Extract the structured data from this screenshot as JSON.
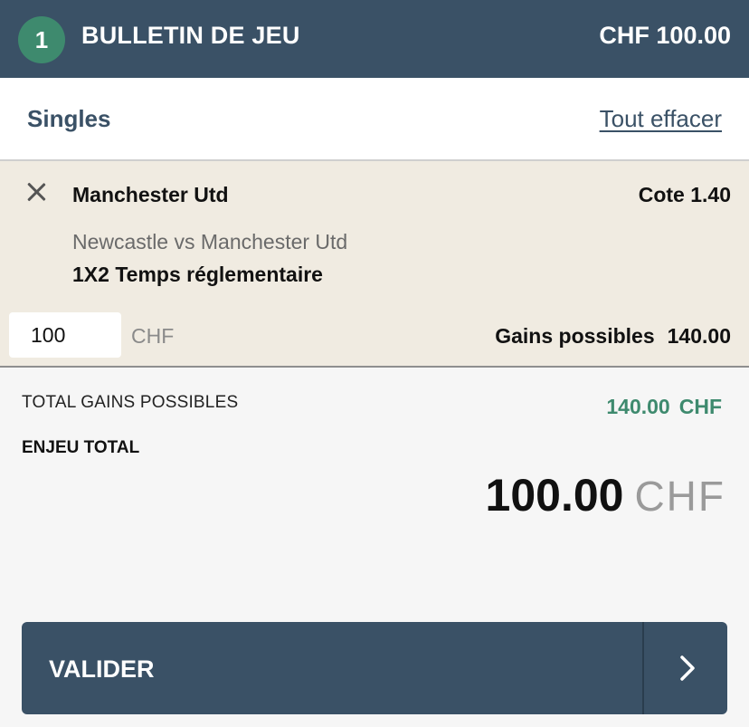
{
  "header": {
    "count": "1",
    "title": "BULLETIN DE JEU",
    "amount": "CHF 100.00"
  },
  "subheader": {
    "type": "Singles",
    "clear_all": "Tout effacer"
  },
  "bet": {
    "selection": "Manchester Utd",
    "odds": "Cote 1.40",
    "match": "Newcastle vs Manchester Utd",
    "market": "1X2 Temps réglementaire",
    "stake_value": "100",
    "stake_currency": "CHF",
    "potential_label": "Gains possibles",
    "potential_value": "140.00"
  },
  "summary": {
    "total_gains_label": "TOTAL GAINS POSSIBLES",
    "total_gains_amount": "140.00",
    "total_gains_currency": "CHF",
    "stake_label": "ENJEU TOTAL",
    "stake_amount": "100.00",
    "stake_currency": "CHF"
  },
  "actions": {
    "validate_label": "VALIDER"
  },
  "colors": {
    "header_bg": "#3a5166",
    "badge_bg": "#3e8a6e",
    "bet_bg": "#f0ebe1",
    "gains_green": "#3e8a6e"
  },
  "icons": {
    "remove": "close-icon",
    "validate": "chevron-right-icon"
  }
}
